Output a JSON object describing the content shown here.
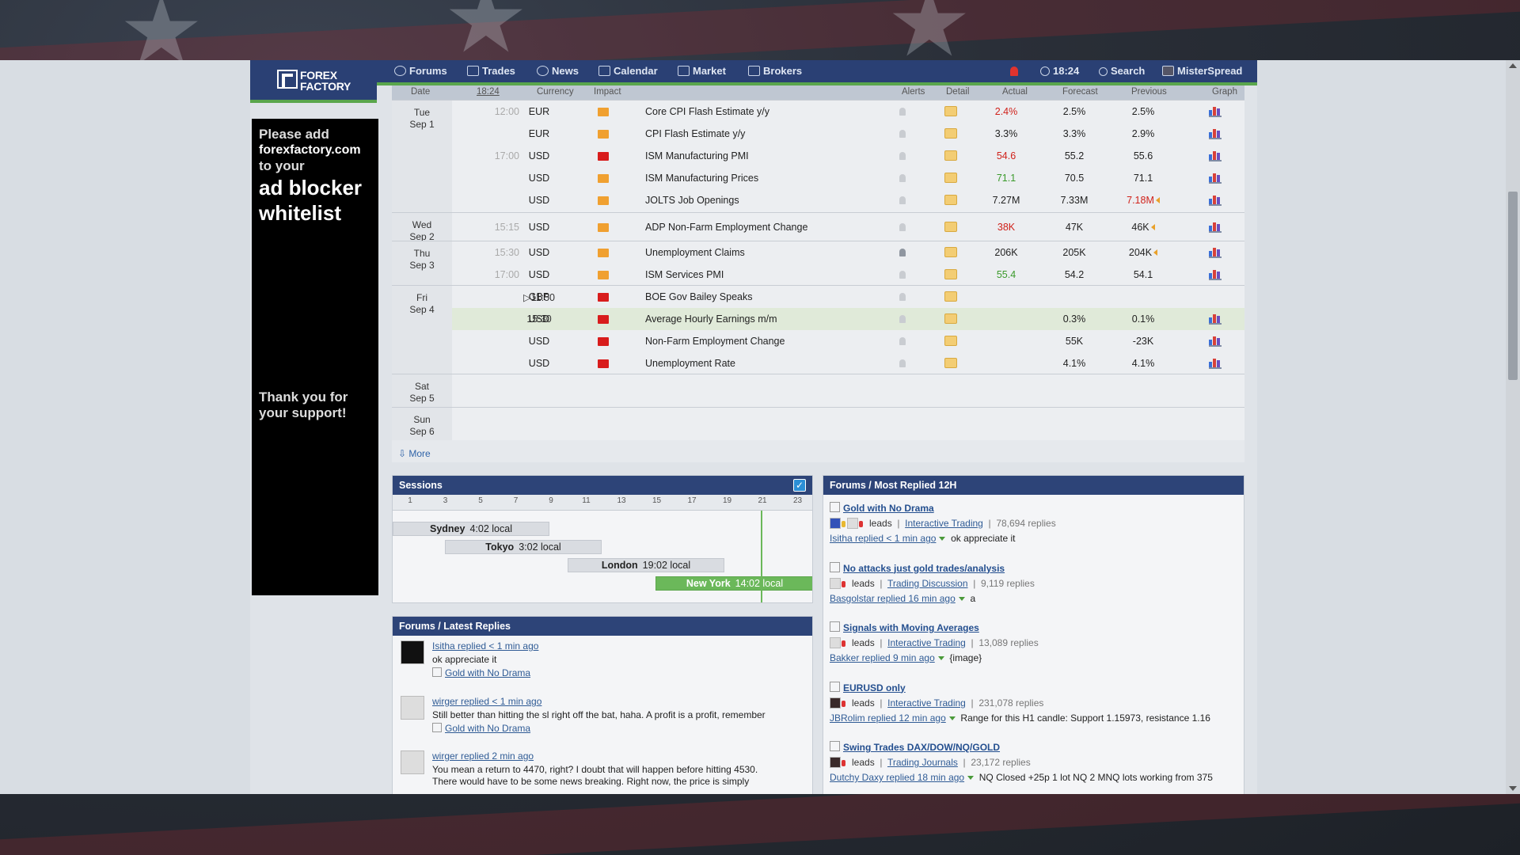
{
  "nav": {
    "logo": "FOREX FACTORY",
    "items": [
      "Forums",
      "Trades",
      "News",
      "Calendar",
      "Market",
      "Brokers"
    ],
    "clock": "18:24",
    "search": "Search",
    "user": "MisterSpread"
  },
  "ad": {
    "line1": "Please add",
    "line2": "forexfactory.com",
    "line3": "to your",
    "line4": "ad blocker",
    "line5": "whitelist",
    "thanks": "Thank you for your support!"
  },
  "calendar": {
    "headers": {
      "date": "Date",
      "time": "18:24",
      "currency": "Currency",
      "impact": "Impact",
      "alerts": "Alerts",
      "detail": "Detail",
      "actual": "Actual",
      "forecast": "Forecast",
      "previous": "Previous",
      "graph": "Graph"
    },
    "days": [
      {
        "dow": "Tue",
        "date": "Sep 1"
      },
      {
        "dow": "Wed",
        "date": "Sep 2"
      },
      {
        "dow": "Thu",
        "date": "Sep 3"
      },
      {
        "dow": "Fri",
        "date": "Sep 4"
      },
      {
        "dow": "Sat",
        "date": "Sep 5"
      },
      {
        "dow": "Sun",
        "date": "Sep 6"
      }
    ],
    "events": [
      {
        "time": "12:00",
        "currency": "EUR",
        "impact": "orange",
        "event": "Core CPI Flash Estimate y/y",
        "actual": "2.4%",
        "actual_color": "red",
        "forecast": "2.5%",
        "previous": "2.5%"
      },
      {
        "time": "",
        "currency": "EUR",
        "impact": "orange",
        "event": "CPI Flash Estimate y/y",
        "actual": "3.3%",
        "actual_color": "black",
        "forecast": "3.3%",
        "previous": "2.9%"
      },
      {
        "time": "17:00",
        "currency": "USD",
        "impact": "red",
        "event": "ISM Manufacturing PMI",
        "actual": "54.6",
        "actual_color": "red",
        "forecast": "55.2",
        "previous": "55.6"
      },
      {
        "time": "",
        "currency": "USD",
        "impact": "orange",
        "event": "ISM Manufacturing Prices",
        "actual": "71.1",
        "actual_color": "green",
        "forecast": "70.5",
        "previous": "71.1"
      },
      {
        "time": "",
        "currency": "USD",
        "impact": "orange",
        "event": "JOLTS Job Openings",
        "actual": "7.27M",
        "actual_color": "black",
        "forecast": "7.33M",
        "previous": "7.18M",
        "previous_color": "red"
      },
      {
        "time": "15:15",
        "currency": "USD",
        "impact": "orange",
        "event": "ADP Non-Farm Employment Change",
        "actual": "38K",
        "actual_color": "red",
        "forecast": "47K",
        "previous": "46K"
      },
      {
        "time": "15:30",
        "currency": "USD",
        "impact": "orange",
        "event": "Unemployment Claims",
        "actual": "206K",
        "actual_color": "black",
        "forecast": "205K",
        "previous": "204K"
      },
      {
        "time": "17:00",
        "currency": "USD",
        "impact": "orange",
        "event": "ISM Services PMI",
        "actual": "55.4",
        "actual_color": "green",
        "forecast": "54.2",
        "previous": "54.1"
      },
      {
        "time": "11:50",
        "currency": "GBP",
        "impact": "red",
        "event": "BOE Gov Bailey Speaks",
        "actual": "",
        "forecast": "",
        "previous": ""
      },
      {
        "time": "15:30",
        "currency": "USD",
        "impact": "red",
        "event": "Average Hourly Earnings m/m",
        "actual": "",
        "forecast": "0.3%",
        "previous": "0.1%"
      },
      {
        "time": "",
        "currency": "USD",
        "impact": "red",
        "event": "Non-Farm Employment Change",
        "actual": "",
        "forecast": "55K",
        "previous": "-23K"
      },
      {
        "time": "",
        "currency": "USD",
        "impact": "red",
        "event": "Unemployment Rate",
        "actual": "",
        "forecast": "4.1%",
        "previous": "4.1%"
      }
    ],
    "more": "More"
  },
  "sessions": {
    "title": "Sessions",
    "ticks": [
      "1",
      "3",
      "5",
      "7",
      "9",
      "11",
      "13",
      "15",
      "17",
      "19",
      "21",
      "23"
    ],
    "items": [
      {
        "city": "Sydney",
        "local": "4:02 local"
      },
      {
        "city": "Tokyo",
        "local": "3:02 local"
      },
      {
        "city": "London",
        "local": "19:02 local"
      },
      {
        "city": "New York",
        "local": "14:02 local"
      }
    ]
  },
  "latest": {
    "title": "Forums / Latest Replies",
    "items": [
      {
        "who": "Isitha replied < 1 min ago",
        "msg": "ok appreciate it",
        "thread": "Gold with No Drama"
      },
      {
        "who": "wirger replied < 1 min ago",
        "msg": "Still better than hitting the sl right off the bat, haha. A profit is a profit, remember",
        "thread": "Gold with No Drama"
      },
      {
        "who": "wirger replied 2 min ago",
        "msg": "You mean a return to 4470, right? I doubt that will happen before hitting 4530.",
        "msg2": "There would have to be some news breaking. Right now, the price is simply",
        "thread": ""
      }
    ]
  },
  "replied": {
    "title": "Forums / Most Replied 12H",
    "items": [
      {
        "title": "Gold with No Drama",
        "leads": "leads",
        "forum": "Interactive Trading",
        "replies": "78,694 replies",
        "last": "Isitha replied < 1 min ago",
        "snippet": "ok appreciate it"
      },
      {
        "title": "No attacks just gold trades/analysis",
        "leads": "leads",
        "forum": "Trading Discussion",
        "replies": "9,119 replies",
        "last": "Basgolstar replied 16 min ago",
        "snippet": "a"
      },
      {
        "title": "Signals with Moving Averages",
        "leads": "leads",
        "forum": "Interactive Trading",
        "replies": "13,089 replies",
        "last": "Bakker replied 9 min ago",
        "snippet": "{image}"
      },
      {
        "title": "EURUSD only",
        "leads": "leads",
        "forum": "Interactive Trading",
        "replies": "231,078 replies",
        "last": "JBRolim replied 12 min ago",
        "snippet": "Range for this H1 candle: Support 1.15973, resistance 1.16"
      },
      {
        "title": "Swing Trades DAX/DOW/NQ/GOLD",
        "leads": "leads",
        "forum": "Trading Journals",
        "replies": "23,172 replies",
        "last": "Dutchy Daxy replied 18 min ago",
        "snippet": "NQ Closed +25p 1 lot NQ 2 MNQ lots working from 375"
      }
    ]
  }
}
